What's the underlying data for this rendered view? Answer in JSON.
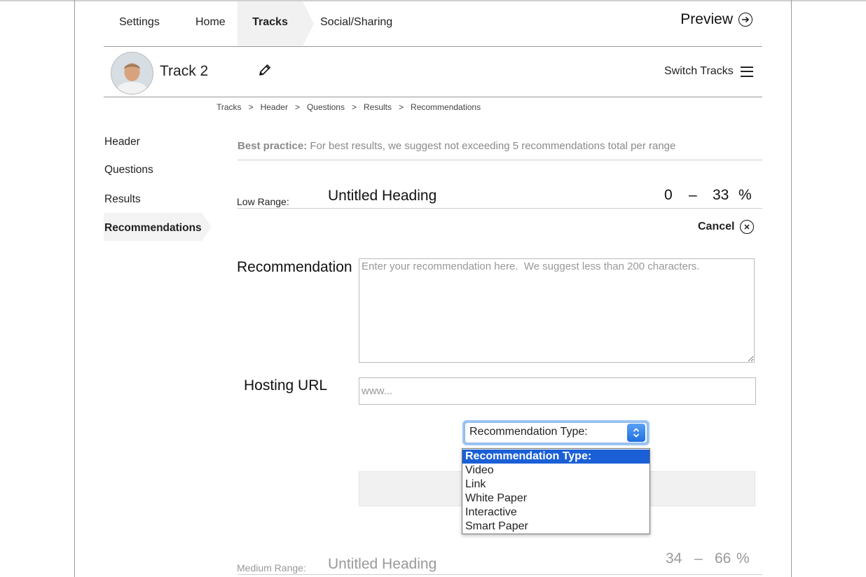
{
  "nav": {
    "tabs": [
      {
        "label": "Settings"
      },
      {
        "label": "Home"
      },
      {
        "label": "Tracks",
        "active": true
      },
      {
        "label": "Social/Sharing"
      }
    ],
    "preview_label": "Preview"
  },
  "track": {
    "name": "Track 2",
    "switch_label": "Switch Tracks"
  },
  "breadcrumb": [
    "Tracks",
    "Header",
    "Questions",
    "Results",
    "Recommendations"
  ],
  "sidebar": {
    "items": [
      {
        "label": "Header"
      },
      {
        "label": "Questions"
      },
      {
        "label": "Results"
      },
      {
        "label": "Recommendations",
        "active": true
      }
    ]
  },
  "best_practice": {
    "prefix": "Best practice:",
    "text": " For best results, we suggest not exceeding 5 recommendations total per range"
  },
  "low_range": {
    "label": "Low Range:",
    "heading": "Untitled Heading",
    "min": "0",
    "dash": "–",
    "max": "33",
    "unit": "%"
  },
  "cancel_label": "Cancel",
  "form": {
    "recommendation_label": "Recommendation",
    "recommendation_placeholder": "Enter your recommendation here.  We suggest less than 200 characters.",
    "hosting_label": "Hosting URL",
    "hosting_placeholder": "www...",
    "type_select": {
      "value": "Recommendation Type:",
      "options": [
        "Recommendation Type:",
        "Video",
        "Link",
        "White Paper",
        "Interactive",
        "Smart Paper"
      ]
    }
  },
  "medium_range": {
    "label": "Medium Range:",
    "heading": "Untitled Heading",
    "min": "34",
    "dash": "–",
    "max": "66",
    "unit": "%"
  },
  "colors": {
    "accent_blue": "#1a5fd6",
    "select_glow": "#9bc4f4",
    "muted_text": "#999999"
  }
}
